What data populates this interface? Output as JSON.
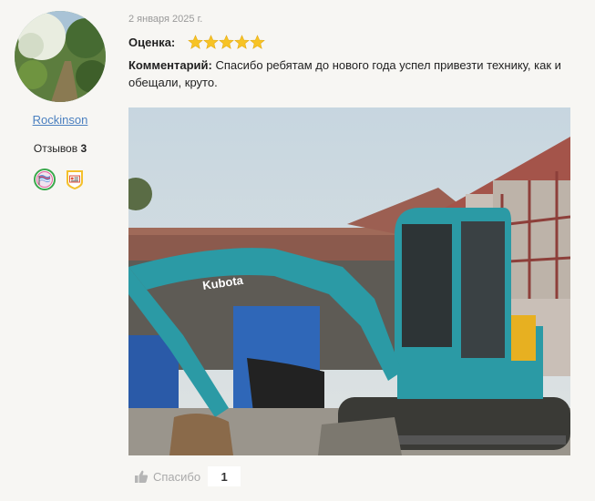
{
  "review": {
    "date": "2 января 2025 г.",
    "rating_label": "Оценка:",
    "rating_value": 5,
    "rating_max": 5,
    "comment_label": "Комментарий:",
    "comment_text": " Спасибо ребятам до нового года успел привезти технику, как и обещали, круто."
  },
  "author": {
    "name": "Rockinson",
    "reviews_label": "Отзывов",
    "reviews_count": "3",
    "badges": [
      "flag-badge-icon",
      "id-card-badge-icon"
    ]
  },
  "photo": {
    "brand_text": "Kubota"
  },
  "thanks": {
    "label": "Спасибо",
    "count": "1"
  },
  "colors": {
    "link": "#4a7fbf",
    "star": "#f7c325",
    "excavator": "#2b9aa5"
  }
}
